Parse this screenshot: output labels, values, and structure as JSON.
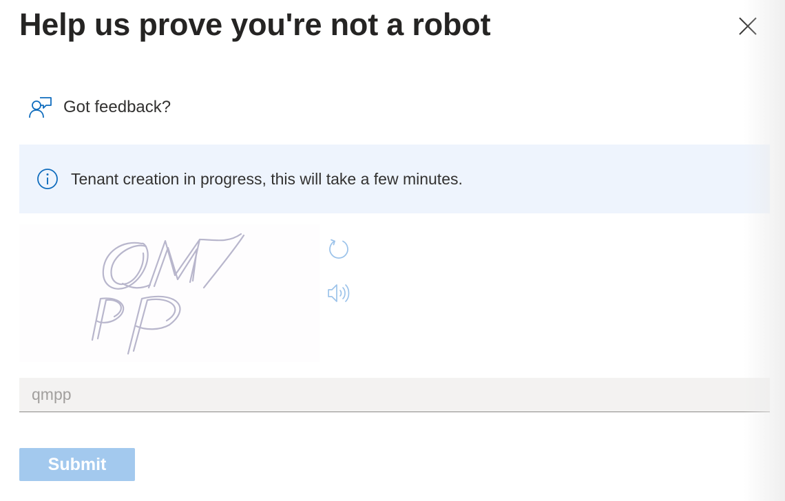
{
  "dialog": {
    "title": "Help us prove you're not a robot",
    "close_icon": "close-icon"
  },
  "feedback": {
    "icon": "feedback-person-icon",
    "label": "Got feedback?"
  },
  "info_bar": {
    "icon": "info-icon",
    "message": "Tenant creation in progress, this will take a few minutes.",
    "background_color": "#eef4fd"
  },
  "captcha": {
    "image_text": "QMPP",
    "refresh_icon": "refresh-icon",
    "audio_icon": "speaker-icon",
    "icon_color": "#9cc3ea"
  },
  "answer_input": {
    "value": "qmpp"
  },
  "submit": {
    "label": "Submit",
    "background_color": "#a3c9ee",
    "disabled": true
  }
}
